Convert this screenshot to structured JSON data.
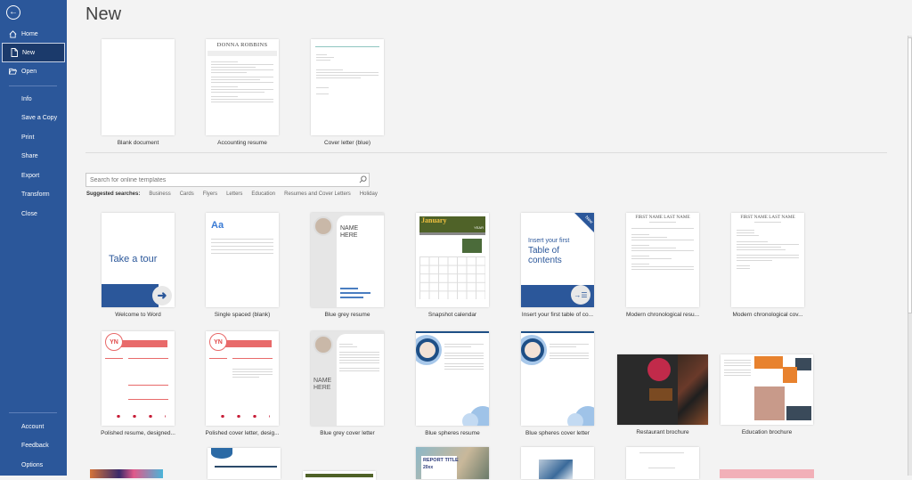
{
  "sidebar": {
    "back_label": "Back",
    "items": [
      {
        "label": "Home",
        "icon": "home-icon"
      },
      {
        "label": "New",
        "icon": "new-document-icon",
        "active": true
      },
      {
        "label": "Open",
        "icon": "folder-open-icon"
      },
      {
        "label": "Info"
      },
      {
        "label": "Save a Copy"
      },
      {
        "label": "Print"
      },
      {
        "label": "Share"
      },
      {
        "label": "Export"
      },
      {
        "label": "Transform"
      },
      {
        "label": "Close"
      }
    ],
    "bottom_items": [
      {
        "label": "Account"
      },
      {
        "label": "Feedback"
      },
      {
        "label": "Options"
      }
    ],
    "colors": {
      "background": "#2b579a",
      "active": "#1b3a6b"
    }
  },
  "main": {
    "title": "New",
    "featured": [
      {
        "label": "Blank document"
      },
      {
        "label": "Accounting resume",
        "heading": "DONNA ROBBINS"
      },
      {
        "label": "Cover letter (blue)"
      }
    ],
    "search": {
      "placeholder": "Search for online templates",
      "value": ""
    },
    "suggested": {
      "label": "Suggested searches:",
      "links": [
        "Business",
        "Cards",
        "Flyers",
        "Letters",
        "Education",
        "Resumes and Cover Letters",
        "Holiday"
      ]
    },
    "templates_row1": [
      {
        "label": "Welcome to Word",
        "thumb_text": "Take a tour"
      },
      {
        "label": "Single spaced (blank)",
        "thumb_text": "Aa"
      },
      {
        "label": "Blue grey resume",
        "thumb_text": "NAME HERE"
      },
      {
        "label": "Snapshot calendar",
        "thumb_text": "January",
        "thumb_sub": "YEAR"
      },
      {
        "label": "Insert your first table of co...",
        "thumb_text": "Insert your first",
        "thumb_text2": "Table of contents",
        "badge": "New"
      },
      {
        "label": "Modern chronological resu...",
        "thumb_text": "FIRST NAME LAST NAME"
      },
      {
        "label": "Modern chronological cov...",
        "thumb_text": "FIRST NAME LAST NAME"
      }
    ],
    "templates_row2": [
      {
        "label": "Polished resume, designed...",
        "thumb_text": "YN"
      },
      {
        "label": "Polished cover letter, desig...",
        "thumb_text": "YN"
      },
      {
        "label": "Blue grey cover letter",
        "thumb_text": "NAME HERE"
      },
      {
        "label": "Blue spheres resume"
      },
      {
        "label": "Blue spheres cover letter"
      },
      {
        "label": "Restaurant brochure"
      },
      {
        "label": "Education brochure"
      }
    ],
    "templates_row3_partial": [
      {
        "thumb_text": ""
      },
      {
        "thumb_text": ""
      },
      {
        "thumb_text": ""
      },
      {
        "thumb_text": "REPORT TITLE",
        "thumb_sub": "20xx"
      },
      {
        "thumb_text": ""
      },
      {
        "thumb_text": ""
      },
      {
        "thumb_text": ""
      }
    ]
  }
}
